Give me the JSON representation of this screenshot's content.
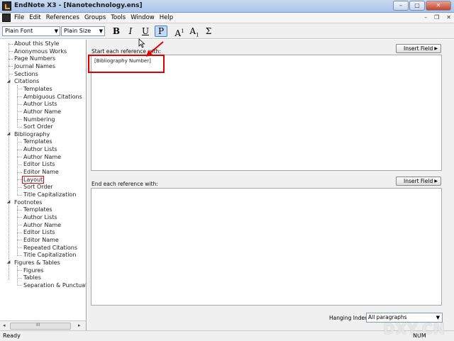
{
  "window": {
    "title": "EndNote X3 - [Nanotechnology.ens]",
    "controls": {
      "minimize": "–",
      "maximize": "□",
      "close": "✕"
    }
  },
  "menubar": {
    "items": [
      "File",
      "Edit",
      "References",
      "Groups",
      "Tools",
      "Window",
      "Help"
    ],
    "mdi_controls": {
      "minimize": "–",
      "restore": "❐",
      "close": "✕"
    }
  },
  "toolbar": {
    "font_value": "Plain Font",
    "size_value": "Plain Size",
    "bold": "B",
    "italic": "I",
    "underline": "U",
    "plain": "P",
    "superscript_base": "A",
    "superscript_mark": "1",
    "subscript_base": "A",
    "subscript_mark": "1",
    "sigma": "Σ"
  },
  "tree": {
    "items": [
      {
        "label": "About this Style",
        "level": 1
      },
      {
        "label": "Anonymous Works",
        "level": 1
      },
      {
        "label": "Page Numbers",
        "level": 1
      },
      {
        "label": "Journal Names",
        "level": 1
      },
      {
        "label": "Sections",
        "level": 1
      },
      {
        "label": "Citations",
        "level": 0,
        "expanded": true
      },
      {
        "label": "Templates",
        "level": 2
      },
      {
        "label": "Ambiguous Citations",
        "level": 2
      },
      {
        "label": "Author Lists",
        "level": 2
      },
      {
        "label": "Author Name",
        "level": 2
      },
      {
        "label": "Numbering",
        "level": 2
      },
      {
        "label": "Sort Order",
        "level": 2
      },
      {
        "label": "Bibliography",
        "level": 0,
        "expanded": true
      },
      {
        "label": "Templates",
        "level": 2
      },
      {
        "label": "Author Lists",
        "level": 2
      },
      {
        "label": "Author Name",
        "level": 2
      },
      {
        "label": "Editor Lists",
        "level": 2
      },
      {
        "label": "Editor Name",
        "level": 2
      },
      {
        "label": "Layout",
        "level": 2,
        "selected": true
      },
      {
        "label": "Sort Order",
        "level": 2
      },
      {
        "label": "Title Capitalization",
        "level": 2
      },
      {
        "label": "Footnotes",
        "level": 0,
        "expanded": true
      },
      {
        "label": "Templates",
        "level": 2
      },
      {
        "label": "Author Lists",
        "level": 2
      },
      {
        "label": "Author Name",
        "level": 2
      },
      {
        "label": "Editor Lists",
        "level": 2
      },
      {
        "label": "Editor Name",
        "level": 2
      },
      {
        "label": "Repeated Citations",
        "level": 2
      },
      {
        "label": "Title Capitalization",
        "level": 2
      },
      {
        "label": "Figures & Tables",
        "level": 0,
        "expanded": true
      },
      {
        "label": "Figures",
        "level": 2
      },
      {
        "label": "Tables",
        "level": 2
      },
      {
        "label": "Separation & Punctuatic",
        "level": 2
      }
    ]
  },
  "scrollbar": {
    "left_arrow": "◂",
    "right_arrow": "▸",
    "grip": "III"
  },
  "layout_panel": {
    "start_label": "Start each reference with:",
    "start_insert_field": "Insert Field",
    "start_content": "[Bibliography Number]",
    "end_label": "End each reference with:",
    "end_insert_field": "Insert Field",
    "end_content": "",
    "hanging_indent_label": "Hanging Indent:",
    "hanging_indent_value": "All paragraphs"
  },
  "statusbar": {
    "status": "Ready",
    "num": "NUM"
  },
  "watermark": "DXY.CN",
  "colors": {
    "annotation_red": "#e00000",
    "selection_blue": "#3d7bcd"
  }
}
